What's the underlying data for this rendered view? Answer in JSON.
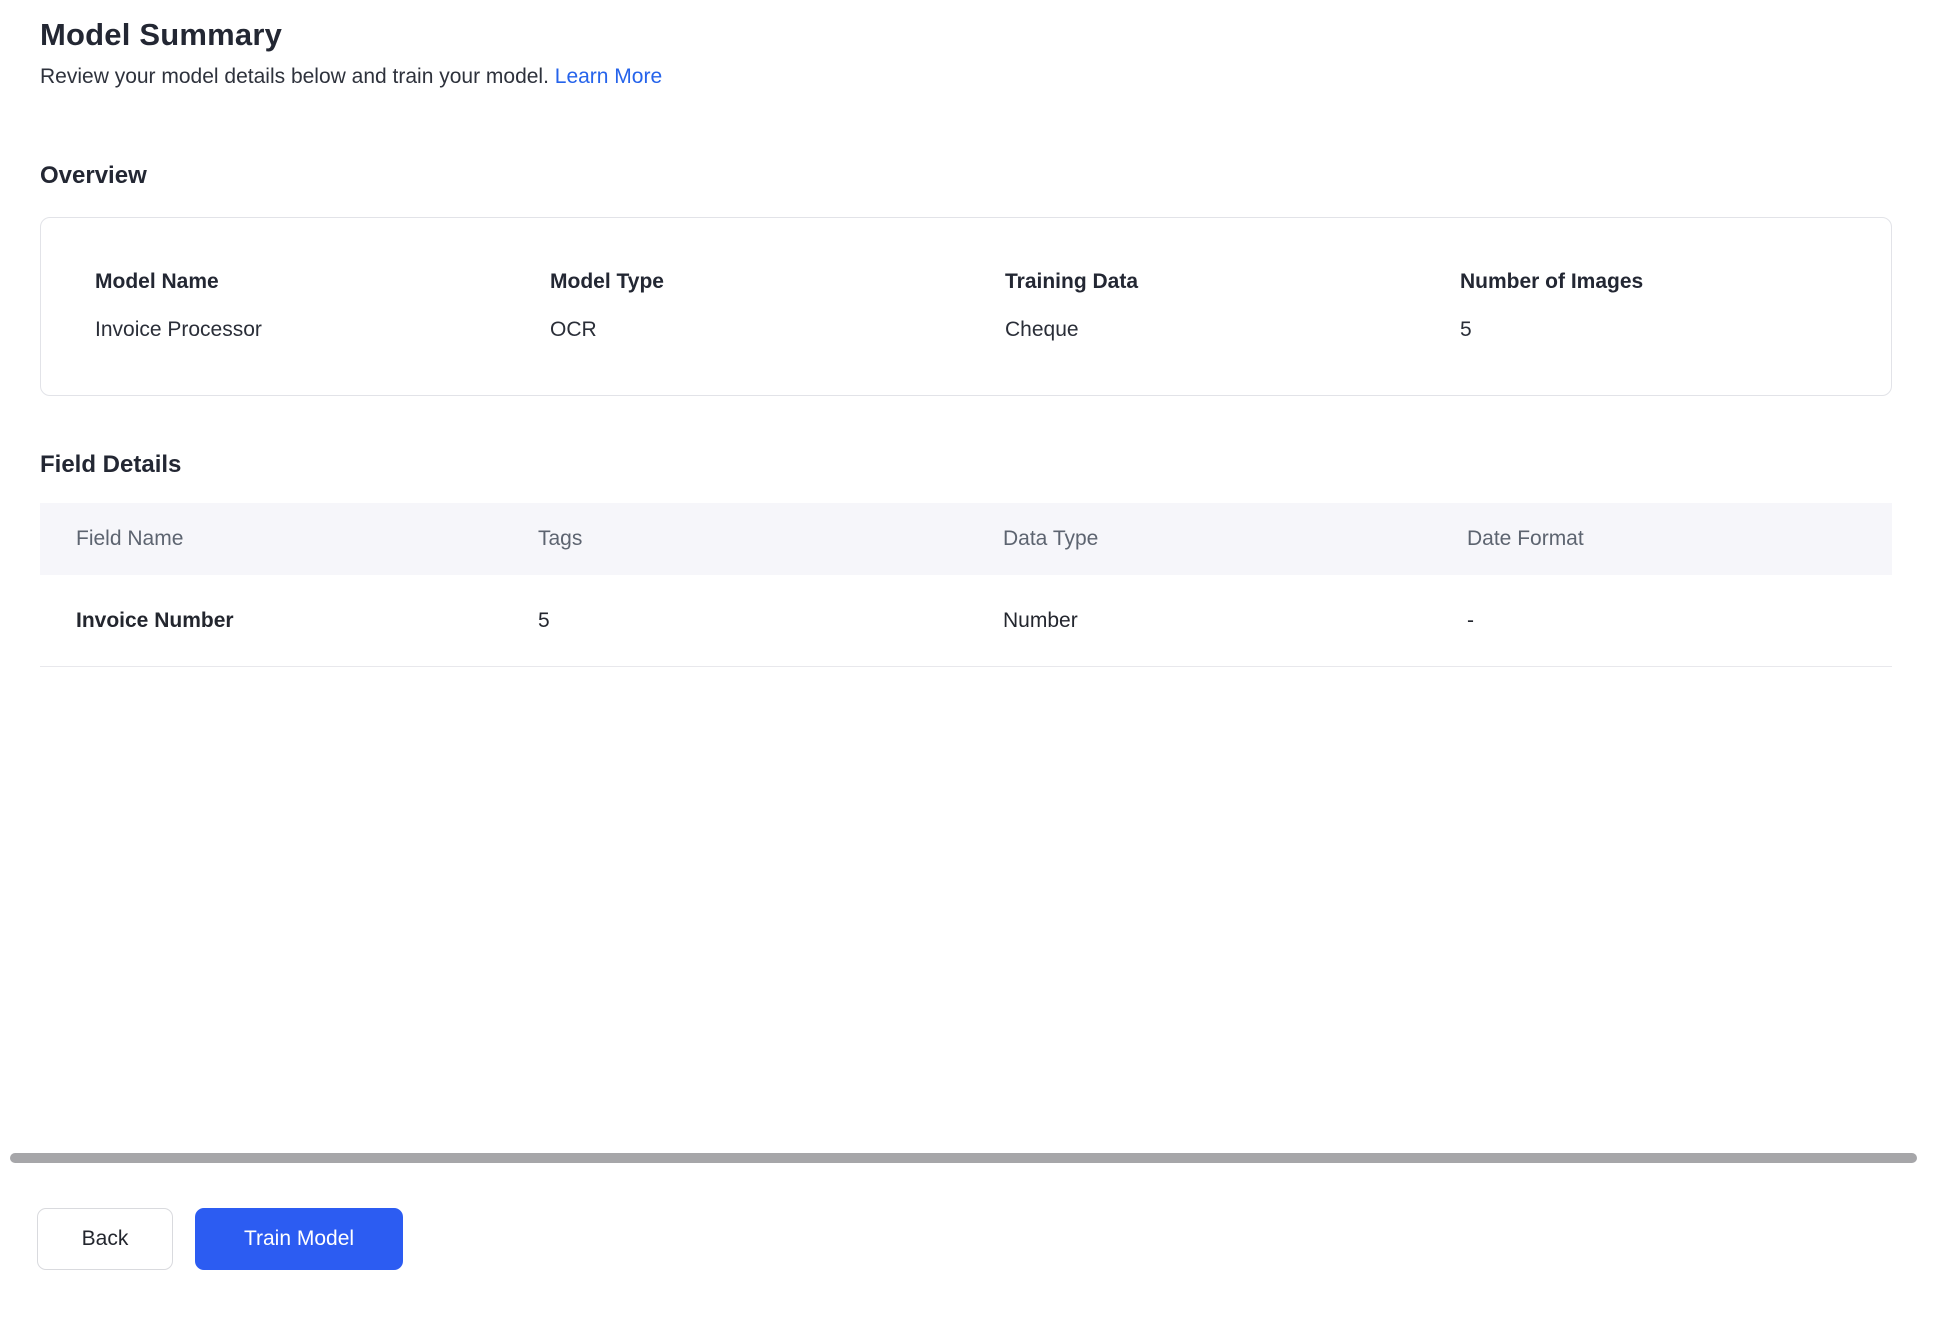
{
  "page": {
    "title": "Model Summary",
    "subtitle": "Review your model details below and train your model.",
    "learn_more_label": "Learn More"
  },
  "overview": {
    "heading": "Overview",
    "fields": [
      {
        "label": "Model Name",
        "value": "Invoice Processor"
      },
      {
        "label": "Model Type",
        "value": "OCR"
      },
      {
        "label": "Training Data",
        "value": "Cheque"
      },
      {
        "label": "Number of Images",
        "value": "5"
      }
    ]
  },
  "field_details": {
    "heading": "Field Details",
    "columns": [
      "Field Name",
      "Tags",
      "Data Type",
      "Date Format"
    ],
    "rows": [
      [
        "Invoice Number",
        "5",
        "Number",
        "-"
      ]
    ]
  },
  "footer": {
    "back_label": "Back",
    "train_label": "Train Model"
  },
  "colors": {
    "accent": "#2c5cf2",
    "link": "#2563eb",
    "table_header_bg": "#f6f6fa"
  }
}
